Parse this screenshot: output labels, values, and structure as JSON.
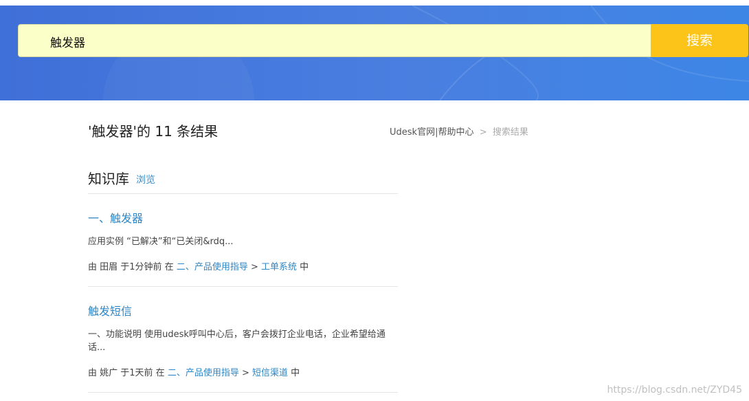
{
  "search": {
    "query": "触发器",
    "button_label": "搜索"
  },
  "results_header": {
    "title": "'触发器'的 11 条结果"
  },
  "breadcrumb": {
    "home": "Udesk官网|帮助中心",
    "separator": ">",
    "current": "搜索结果"
  },
  "knowledge_base": {
    "title": "知识库",
    "browse_label": "浏览"
  },
  "results": [
    {
      "title": "一、触发器",
      "snippet": "应用实例 “已解决”和“已关闭&rdq...",
      "meta_prefix": "由 田眉 于1分钟前 在",
      "category": "二、产品使用指导",
      "arrow": ">",
      "subcategory": "工单系统",
      "meta_suffix": "中"
    },
    {
      "title": "触发短信",
      "snippet": "一、功能说明 使用udesk呼叫中心后，客户会拨打企业电话，企业希望给通话...",
      "meta_prefix": "由 姚广 于1天前 在",
      "category": "二、产品使用指导",
      "arrow": ">",
      "subcategory": "短信渠道",
      "meta_suffix": "中"
    }
  ],
  "watermark": "https://blog.csdn.net/ZYD45",
  "colors": {
    "hero_blue": "#4a7fe0",
    "search_bg": "#fbffc8",
    "button_yellow": "#fcc419",
    "link_blue": "#2f86c4"
  }
}
